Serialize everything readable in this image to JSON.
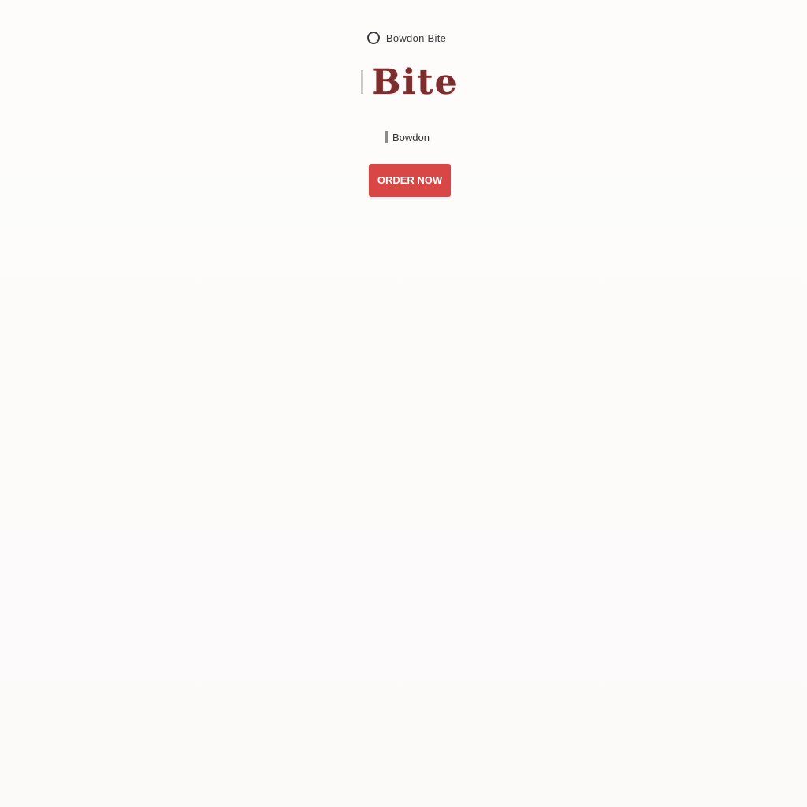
{
  "header": {
    "brand_small": "Bowdon Bite",
    "extra": ""
  },
  "brand": {
    "logo_text": "Bite"
  },
  "intro": {
    "line1": "",
    "line2": ""
  },
  "meta": {
    "label": "Bowdon",
    "dim": ""
  },
  "cta": {
    "label": "ORDER NOW"
  },
  "note": {
    "label": ""
  },
  "paragraph": {
    "line1": "",
    "line2": ""
  },
  "footer": {
    "line1": "",
    "line2": "",
    "line3": ""
  },
  "colors": {
    "accent": "#d94646",
    "logo": "#7a2e2e",
    "background": "#fcfbfa"
  }
}
